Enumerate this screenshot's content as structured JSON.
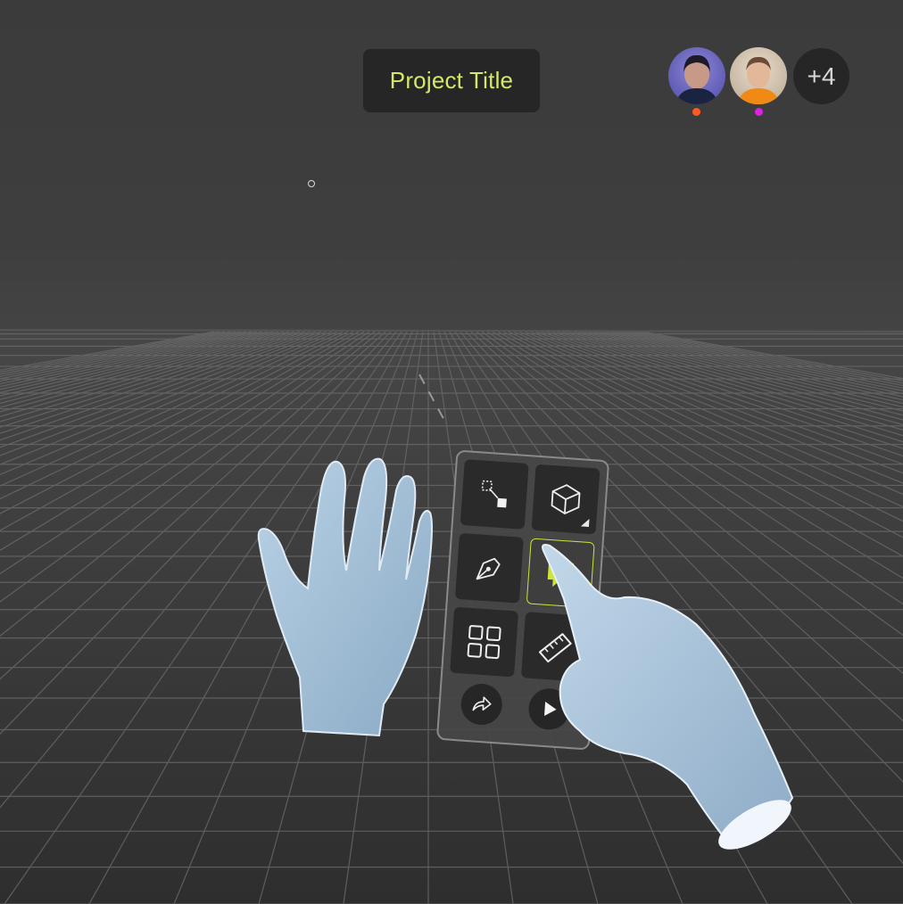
{
  "project": {
    "title": "Project Title"
  },
  "collaborators": {
    "users": [
      {
        "name": "collaborator-1",
        "presence_color": "#ff5a1f"
      },
      {
        "name": "collaborator-2",
        "presence_color": "#e020e0"
      }
    ],
    "overflow_label": "+4"
  },
  "toolbar": {
    "accent_color": "#cde43a",
    "tools": [
      {
        "icon": "select-transform-icon",
        "active": false
      },
      {
        "icon": "cube-icon",
        "active": false,
        "has_submenu": true
      },
      {
        "icon": "pen-tool-icon",
        "active": false
      },
      {
        "icon": "comment-icon",
        "active": true
      },
      {
        "icon": "grid-icon",
        "active": false
      },
      {
        "icon": "ruler-icon",
        "active": false
      }
    ],
    "actions": [
      {
        "icon": "share-icon"
      },
      {
        "icon": "play-icon"
      }
    ]
  }
}
